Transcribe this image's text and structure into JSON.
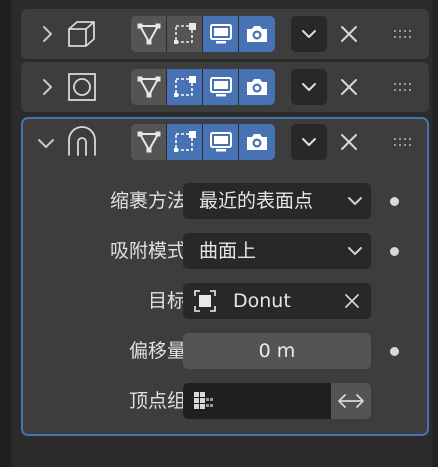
{
  "modifiers": [
    {
      "name": "modifier-cube",
      "type_icon": "cube-modifier-icon",
      "expanded": false,
      "toggles": {
        "edit_mode": false,
        "cage": false,
        "viewport": true,
        "render": true
      }
    },
    {
      "name": "modifier-circle",
      "type_icon": "circle-modifier-icon",
      "expanded": false,
      "toggles": {
        "edit_mode": false,
        "cage": true,
        "viewport": true,
        "render": true
      }
    },
    {
      "name": "modifier-shrinkwrap",
      "type_icon": "shrinkwrap-modifier-icon",
      "expanded": true,
      "toggles": {
        "edit_mode": false,
        "cage": true,
        "viewport": true,
        "render": true
      }
    }
  ],
  "shrinkwrap": {
    "wrap_method": {
      "label": "缩裹方法",
      "value": "最近的表面点"
    },
    "snap_mode": {
      "label": "吸附模式",
      "value": "曲面上"
    },
    "target": {
      "label": "目标",
      "value": "Donut"
    },
    "offset": {
      "label": "偏移量",
      "value": "0 m"
    },
    "vertex_group": {
      "label": "顶点组",
      "value": ""
    }
  },
  "colors": {
    "accent": "#4772b3",
    "panel": "#3d3d3d",
    "field": "#282828",
    "button": "#545454"
  }
}
